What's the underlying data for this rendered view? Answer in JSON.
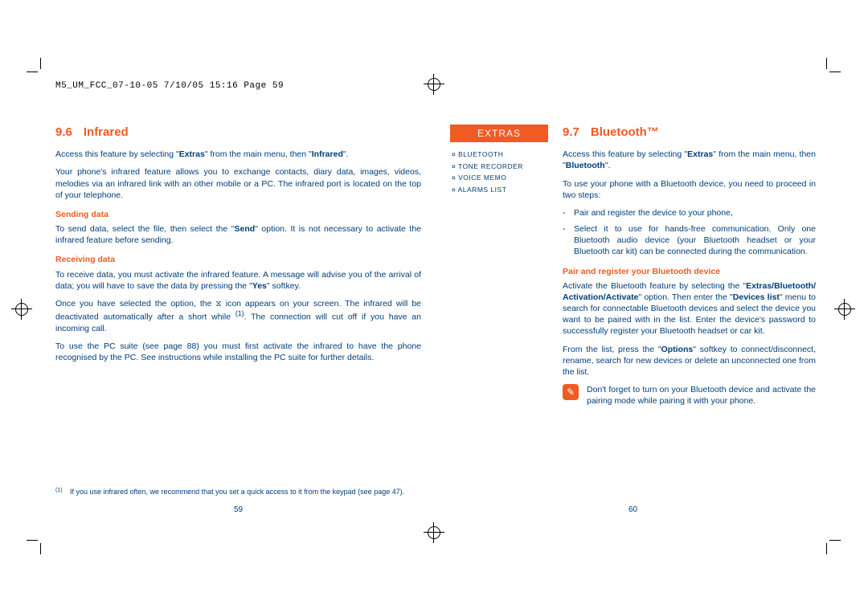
{
  "header": "M5_UM_FCC_07-10-05  7/10/05  15:16  Page 59",
  "left": {
    "num": "9.6",
    "title": "Infrared",
    "intro_a": "Access this feature by selecting \"",
    "intro_b": "Extras",
    "intro_c": "\" from the main menu, then \"",
    "intro_d": "Infrared",
    "intro_e": "\".",
    "desc": "Your phone's infrared feature allows you to exchange contacts, diary data, images, videos, melodies via an infrared link with an other mobile or a PC. The infrared port is located on the top of your telephone.",
    "h_send": "Sending data",
    "send_a": "To send data, select the file, then select the \"",
    "send_b": "Send",
    "send_c": "\" option. It is not necessary to activate the infrared feature before sending.",
    "h_recv": "Receiving data",
    "recv_a": "To receive data, you must activate the infrared feature. A message will advise you of the arrival of data; you will have to save the data by pressing the \"",
    "recv_b": "Yes",
    "recv_c": "\" softkey.",
    "recv2_a": "Once you have selected the option, the  ",
    "recv2_b": "  icon appears on your screen. The infrared will be deactivated automatically after a short while ",
    "recv2_c": ". The connection will cut off if you have an incoming call.",
    "pc": "To use the PC suite (see page 88) you must first activate the infrared to have the phone recognised by the PC. See instructions while installing the PC suite for further details.",
    "fnmark": "(1)",
    "fn": "If you use infrared often, we recommend that you set a quick access to it from the keypad (see page 47).",
    "pagenum": "59"
  },
  "right": {
    "extras_title": "EXTRAS",
    "extras_items": [
      "¤  BLUETOOTH",
      "¤  TONE RECORDER",
      "¤  VOICE MEMO",
      "¤  ALARMS LIST"
    ],
    "num": "9.7",
    "title": "Bluetooth™",
    "intro_a": "Access this feature by selecting \"",
    "intro_b": "Extras",
    "intro_c": "\" from the main menu, then \"",
    "intro_d": "Bluetooth",
    "intro_e": "\".",
    "steps_intro": "To use your phone with a Bluetooth device, you need to proceed in two steps:",
    "step1": "Pair and register the device to your phone,",
    "step2": "Select it to use for hands-free communication. Only one Bluetooth audio device (your Bluetooth headset or your Bluetooth car kit) can be connected during the communication.",
    "h_pair": "Pair and register your Bluetooth device",
    "pair_a": "Activate the Bluetooth feature by selecting the \"",
    "pair_b": "Extras/Bluetooth/ Activation/Activate",
    "pair_c": "\" option. Then enter the \"",
    "pair_d": "Devices list",
    "pair_e": "\" menu to search for connectable Bluetooth devices and select the device you want to be paired with in the list. Enter the device's password to successfully register your Bluetooth headset or car kit.",
    "opt_a": "From the list, press the \"",
    "opt_b": "Options",
    "opt_c": "\" softkey to connect/disconnect, rename, search for new devices or delete an unconnected one from the list.",
    "note": "Don't forget to turn on your Bluetooth device and activate the pairing mode while pairing it with your phone.",
    "pagenum": "60"
  }
}
